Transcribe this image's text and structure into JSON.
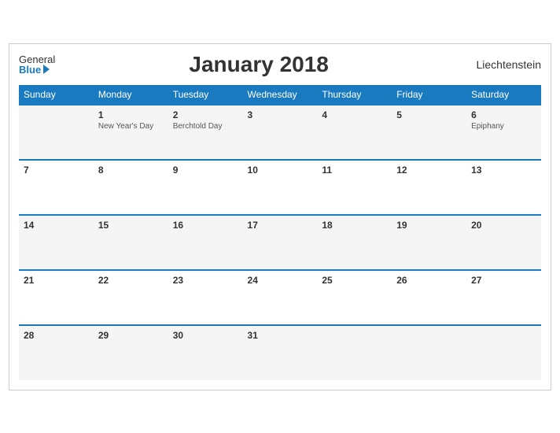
{
  "header": {
    "logo_general": "General",
    "logo_blue": "Blue",
    "title": "January 2018",
    "country": "Liechtenstein"
  },
  "weekdays": [
    "Sunday",
    "Monday",
    "Tuesday",
    "Wednesday",
    "Thursday",
    "Friday",
    "Saturday"
  ],
  "weeks": [
    [
      {
        "day": "",
        "holiday": ""
      },
      {
        "day": "1",
        "holiday": "New Year's Day"
      },
      {
        "day": "2",
        "holiday": "Berchtold Day"
      },
      {
        "day": "3",
        "holiday": ""
      },
      {
        "day": "4",
        "holiday": ""
      },
      {
        "day": "5",
        "holiday": ""
      },
      {
        "day": "6",
        "holiday": "Epiphany"
      }
    ],
    [
      {
        "day": "7",
        "holiday": ""
      },
      {
        "day": "8",
        "holiday": ""
      },
      {
        "day": "9",
        "holiday": ""
      },
      {
        "day": "10",
        "holiday": ""
      },
      {
        "day": "11",
        "holiday": ""
      },
      {
        "day": "12",
        "holiday": ""
      },
      {
        "day": "13",
        "holiday": ""
      }
    ],
    [
      {
        "day": "14",
        "holiday": ""
      },
      {
        "day": "15",
        "holiday": ""
      },
      {
        "day": "16",
        "holiday": ""
      },
      {
        "day": "17",
        "holiday": ""
      },
      {
        "day": "18",
        "holiday": ""
      },
      {
        "day": "19",
        "holiday": ""
      },
      {
        "day": "20",
        "holiday": ""
      }
    ],
    [
      {
        "day": "21",
        "holiday": ""
      },
      {
        "day": "22",
        "holiday": ""
      },
      {
        "day": "23",
        "holiday": ""
      },
      {
        "day": "24",
        "holiday": ""
      },
      {
        "day": "25",
        "holiday": ""
      },
      {
        "day": "26",
        "holiday": ""
      },
      {
        "day": "27",
        "holiday": ""
      }
    ],
    [
      {
        "day": "28",
        "holiday": ""
      },
      {
        "day": "29",
        "holiday": ""
      },
      {
        "day": "30",
        "holiday": ""
      },
      {
        "day": "31",
        "holiday": ""
      },
      {
        "day": "",
        "holiday": ""
      },
      {
        "day": "",
        "holiday": ""
      },
      {
        "day": "",
        "holiday": ""
      }
    ]
  ]
}
